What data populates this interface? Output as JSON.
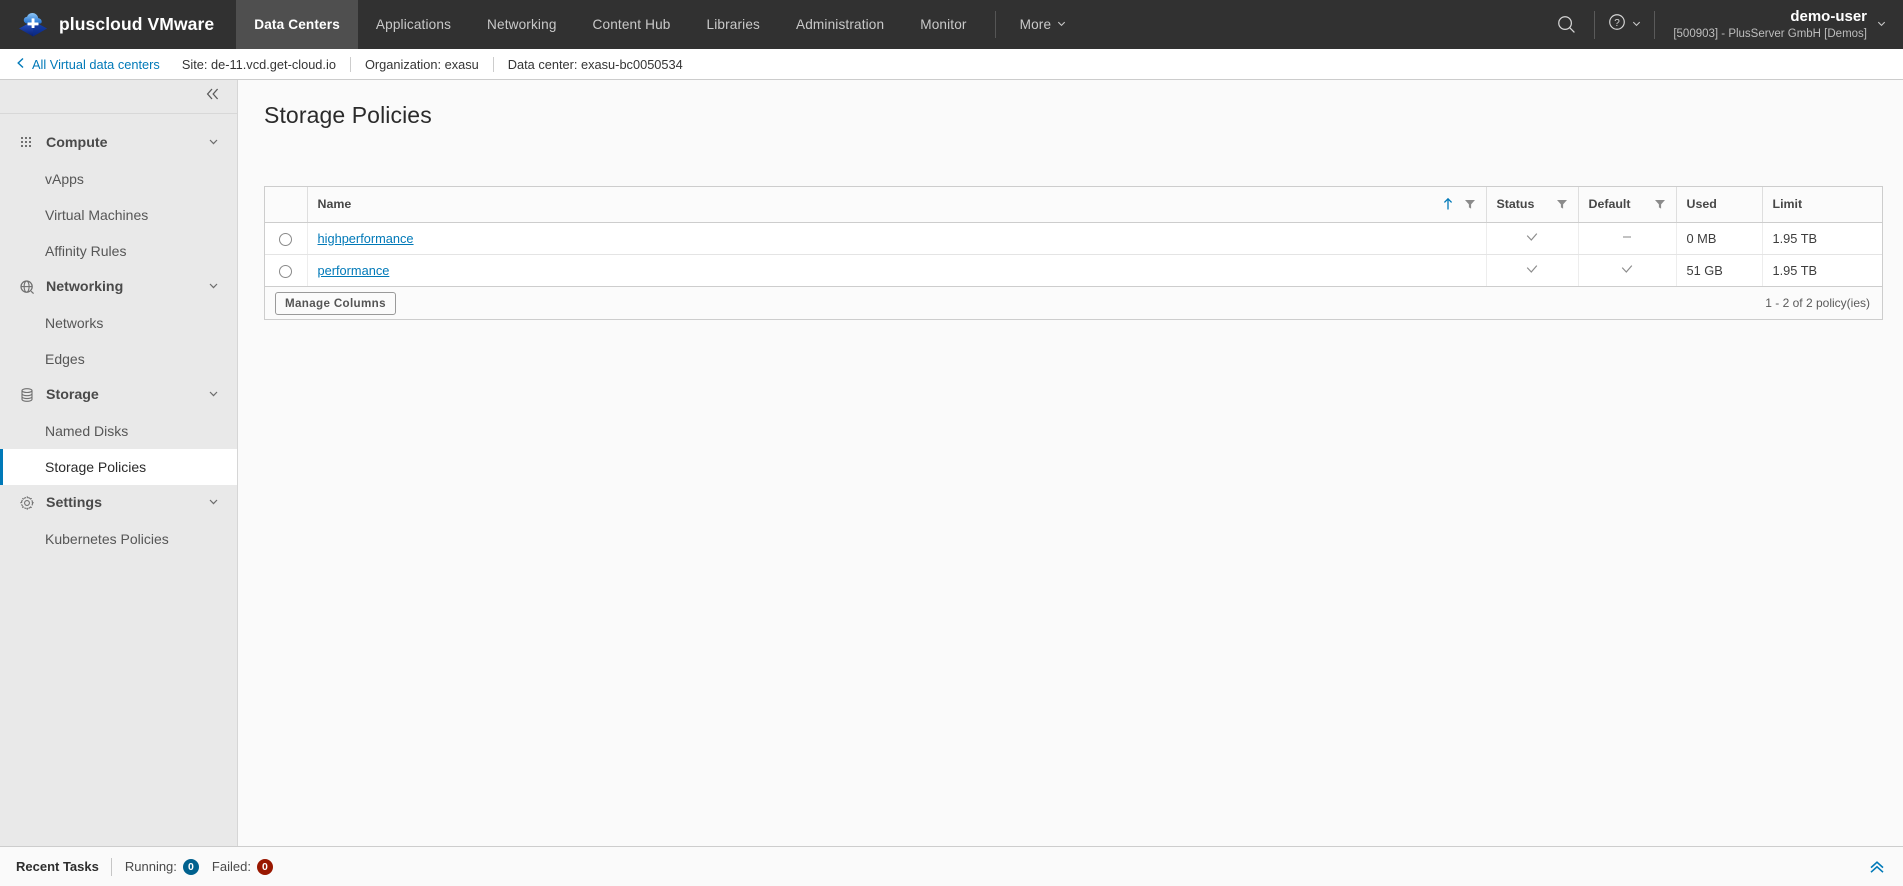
{
  "header": {
    "brand": "pluscloud VMware",
    "logo_icon": "cloud-plus-logo-icon",
    "nav": [
      {
        "label": "Data Centers",
        "active": true
      },
      {
        "label": "Applications",
        "active": false
      },
      {
        "label": "Networking",
        "active": false
      },
      {
        "label": "Content Hub",
        "active": false
      },
      {
        "label": "Libraries",
        "active": false
      },
      {
        "label": "Administration",
        "active": false
      },
      {
        "label": "Monitor",
        "active": false
      }
    ],
    "more_label": "More",
    "search_icon": "search-icon",
    "help_icon": "help-circle-icon",
    "user_name": "demo-user",
    "user_org": "[500903] - PlusServer GmbH [Demos]"
  },
  "breadcrumb": {
    "back_label": "All Virtual data centers",
    "items": [
      "Site: de-11.vcd.get-cloud.io",
      "Organization: exasu",
      "Data center: exasu-bc0050534"
    ]
  },
  "sidebar": {
    "collapse_icon": "double-chevron-left-icon",
    "groups": [
      {
        "label": "Compute",
        "icon": "grid-dots-icon",
        "items": [
          {
            "label": "vApps",
            "selected": false
          },
          {
            "label": "Virtual Machines",
            "selected": false
          },
          {
            "label": "Affinity Rules",
            "selected": false
          }
        ]
      },
      {
        "label": "Networking",
        "icon": "globe-icon",
        "items": [
          {
            "label": "Networks",
            "selected": false
          },
          {
            "label": "Edges",
            "selected": false
          }
        ]
      },
      {
        "label": "Storage",
        "icon": "database-icon",
        "items": [
          {
            "label": "Named Disks",
            "selected": false
          },
          {
            "label": "Storage Policies",
            "selected": true
          }
        ]
      },
      {
        "label": "Settings",
        "icon": "gear-icon",
        "items": [
          {
            "label": "Kubernetes Policies",
            "selected": false
          }
        ]
      }
    ]
  },
  "main": {
    "page_title": "Storage Policies",
    "table": {
      "columns": [
        {
          "key": "name",
          "label": "Name",
          "sorted": "asc",
          "filter": true,
          "align": "left"
        },
        {
          "key": "status",
          "label": "Status",
          "sorted": null,
          "filter": true,
          "align": "center"
        },
        {
          "key": "default",
          "label": "Default",
          "sorted": null,
          "filter": true,
          "align": "center"
        },
        {
          "key": "used",
          "label": "Used",
          "sorted": null,
          "filter": false,
          "align": "left"
        },
        {
          "key": "limit",
          "label": "Limit",
          "sorted": null,
          "filter": false,
          "align": "left"
        }
      ],
      "rows": [
        {
          "selected": false,
          "name": "highperformance",
          "status": "check",
          "default": "dash",
          "used": "0 MB",
          "limit": "1.95 TB"
        },
        {
          "selected": false,
          "name": "performance",
          "status": "check",
          "default": "check",
          "used": "51 GB",
          "limit": "1.95 TB"
        }
      ],
      "manage_columns_label": "Manage Columns",
      "count_label": "1 - 2 of 2 policy(ies)"
    }
  },
  "footer": {
    "title": "Recent Tasks",
    "running_label": "Running:",
    "running_count": "0",
    "running_color": "#00618e",
    "failed_label": "Failed:",
    "failed_count": "0",
    "failed_color": "#991700",
    "expand_icon": "double-chevron-up-icon"
  },
  "colors": {
    "accent": "#0079b8",
    "header_bg": "#313131",
    "sidebar_bg": "#e9e9e9"
  }
}
